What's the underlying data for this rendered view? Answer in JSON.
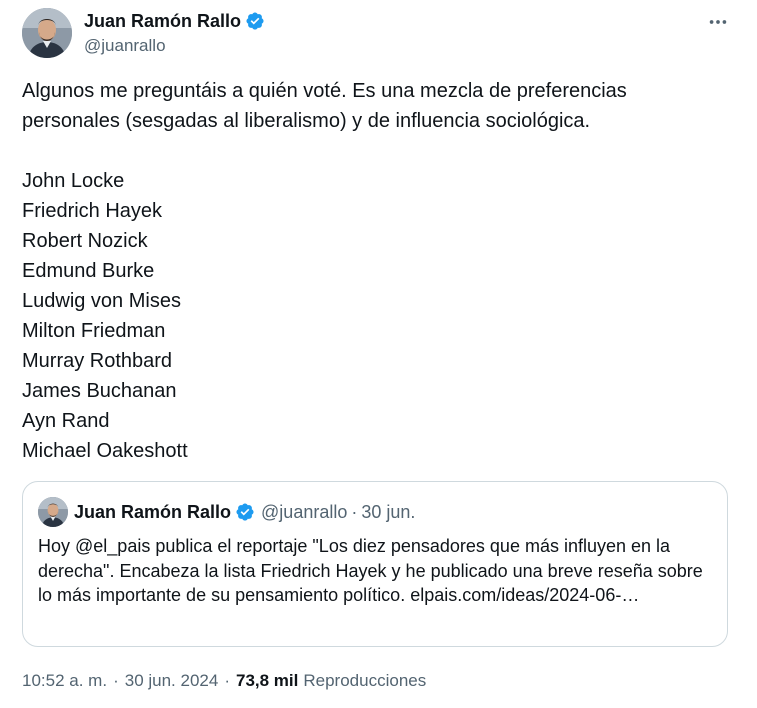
{
  "author": {
    "name": "Juan Ramón Rallo",
    "handle": "@juanrallo",
    "verified": true
  },
  "tweet": {
    "intro": "Algunos me preguntáis a quién voté. Es una mezcla de preferencias personales (sesgadas al liberalismo) y de influencia sociológica.",
    "names": [
      "John Locke",
      "Friedrich Hayek",
      "Robert Nozick",
      "Edmund Burke",
      "Ludwig von Mises",
      "Milton Friedman",
      "Murray Rothbard",
      "James Buchanan",
      "Ayn Rand",
      "Michael Oakeshott"
    ]
  },
  "quote": {
    "name": "Juan Ramón Rallo",
    "handle": "@juanrallo",
    "separator": "·",
    "date": "30 jun.",
    "text": "Hoy @el_pais publica el reportaje \"Los diez pensadores que más influyen en la derecha\". Encabeza la lista Friedrich Hayek y he publicado una breve reseña sobre lo más importante de su pensamiento político. elpais.com/ideas/2024-06-…"
  },
  "meta": {
    "time": "10:52 a. m.",
    "separator": "·",
    "date": "30 jun. 2024",
    "views_count": "73,8 mil",
    "views_label": "Reproducciones"
  },
  "icons": {
    "verified": "verified-badge-icon",
    "more": "more-options-icon"
  },
  "colors": {
    "verified_blue": "#1d9bf0",
    "text_primary": "#0f1419",
    "text_secondary": "#536471",
    "border": "#cfd9de"
  }
}
